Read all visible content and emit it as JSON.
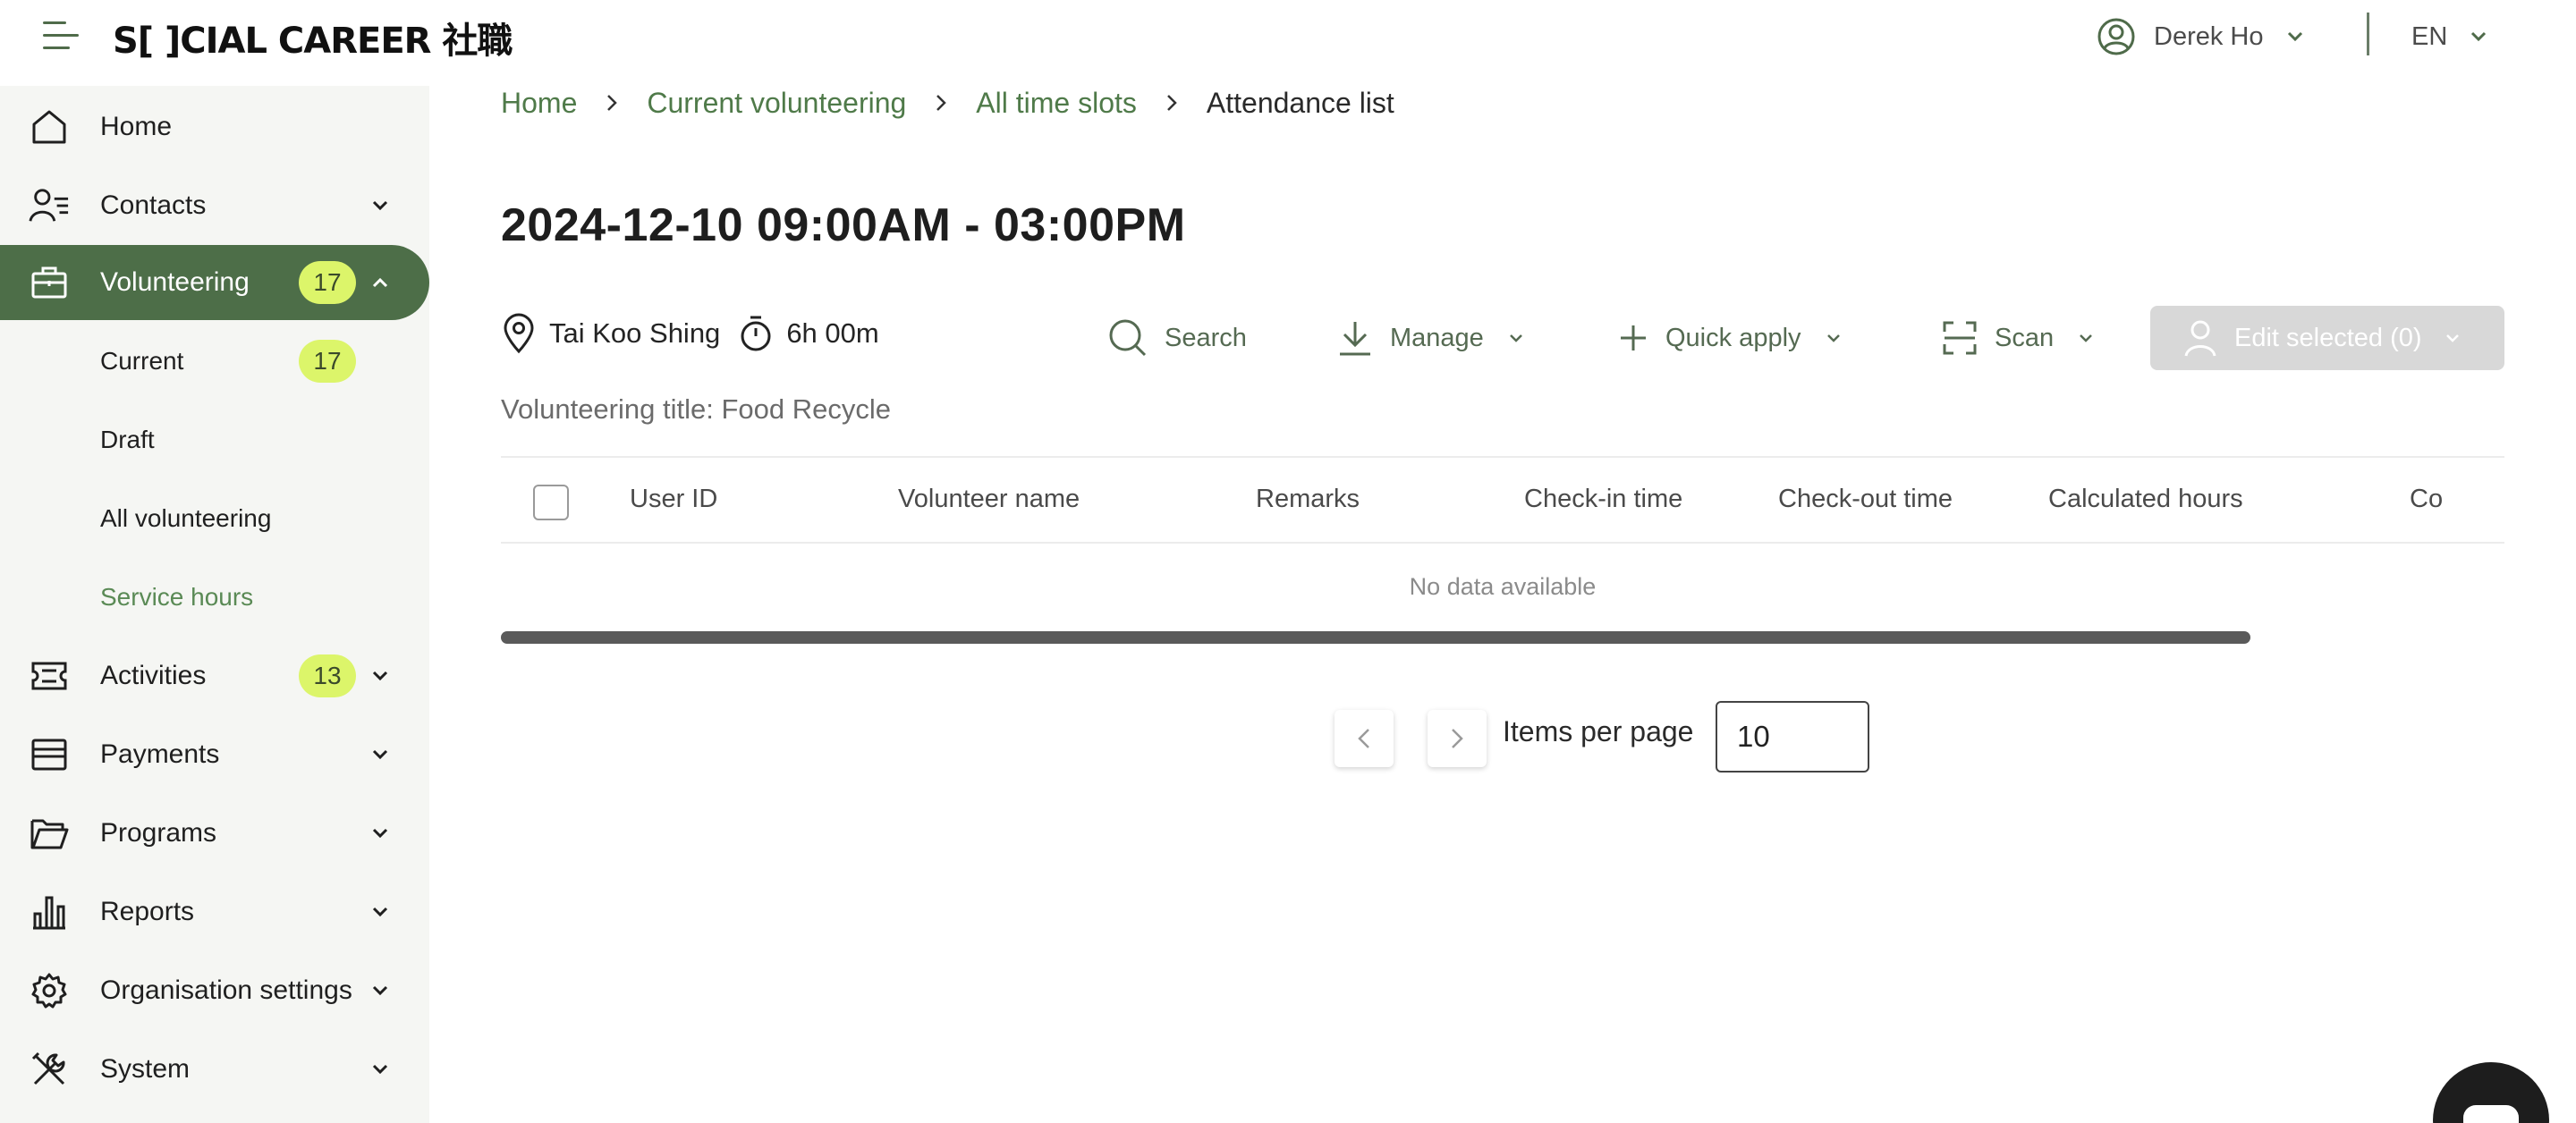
{
  "app": {
    "logo_text": "S[ ]CIAL CAREER 社職",
    "user_name": "Derek Ho",
    "language": "EN"
  },
  "sidebar": {
    "items": [
      {
        "label": "Home",
        "icon": "home-icon"
      },
      {
        "label": "Contacts",
        "icon": "contacts-icon"
      },
      {
        "label": "Volunteering",
        "icon": "briefcase-icon",
        "badge": "17",
        "active": true
      },
      {
        "label": "Current",
        "badge": "17",
        "sub": true
      },
      {
        "label": "Draft",
        "sub": true
      },
      {
        "label": "All volunteering",
        "sub": true
      },
      {
        "label": "Service hours",
        "sub": true,
        "highlight": true
      },
      {
        "label": "Activities",
        "icon": "ticket-icon",
        "badge": "13"
      },
      {
        "label": "Payments",
        "icon": "card-icon"
      },
      {
        "label": "Programs",
        "icon": "folder-icon"
      },
      {
        "label": "Reports",
        "icon": "bar-chart-icon"
      },
      {
        "label": "Organisation settings",
        "icon": "gear-icon"
      },
      {
        "label": "System",
        "icon": "tools-icon"
      }
    ]
  },
  "breadcrumb": [
    "Home",
    "Current volunteering",
    "All time slots",
    "Attendance list"
  ],
  "page": {
    "title": "2024-12-10 09:00AM - 03:00PM",
    "location": "Tai Koo Shing",
    "duration": "6h 00m",
    "volunteering_title": "Volunteering title: Food Recycle"
  },
  "actions": {
    "search": "Search",
    "manage": "Manage",
    "quick_apply": "Quick apply",
    "scan": "Scan",
    "edit_selected": "Edit selected (0)"
  },
  "table": {
    "columns": [
      "User ID",
      "Volunteer name",
      "Remarks",
      "Check-in time",
      "Check-out time",
      "Calculated hours",
      "Co"
    ],
    "empty_text": "No data available"
  },
  "pagination": {
    "items_per_page_label": "Items per page",
    "items_per_page_value": "10"
  },
  "colors": {
    "accent": "#4d6e48",
    "badge": "#dcf56a",
    "link": "#4f7a49"
  }
}
